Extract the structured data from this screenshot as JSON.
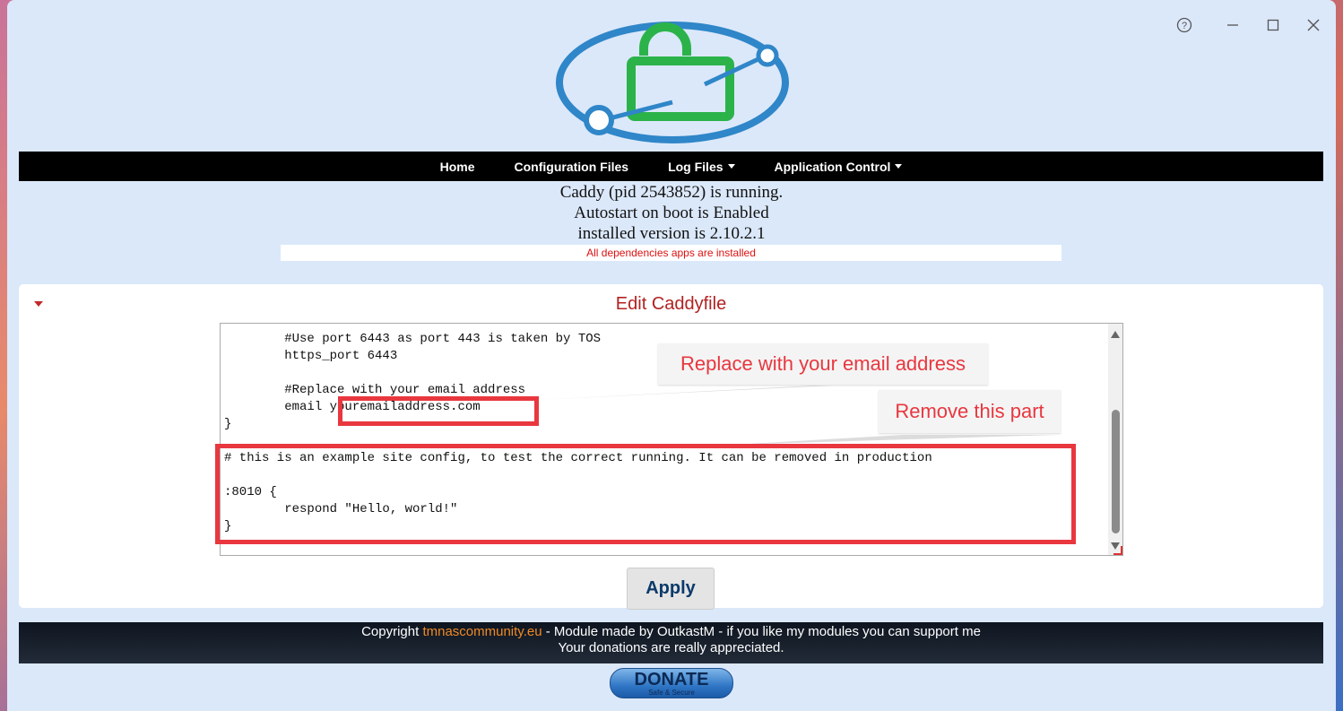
{
  "window": {
    "help_icon": "question-circle-icon",
    "minimize_icon": "minimize-icon",
    "maximize_icon": "maximize-icon",
    "close_icon": "close-icon"
  },
  "nav": {
    "items": [
      {
        "label": "Home",
        "dropdown": false
      },
      {
        "label": "Configuration Files",
        "dropdown": false
      },
      {
        "label": "Log Files",
        "dropdown": true
      },
      {
        "label": "Application Control",
        "dropdown": true
      }
    ]
  },
  "status": {
    "line1": "Caddy (pid 2543852) is running.",
    "line2": "Autostart on boot is Enabled",
    "line3": "installed version is 2.10.2.1",
    "deps": "All dependencies apps are installed"
  },
  "panel": {
    "title": "Edit Caddyfile",
    "apply_label": "Apply"
  },
  "editor": {
    "lines": [
      "        #Use port 6443 as port 443 is taken by TOS",
      "        https_port 6443",
      "",
      "        #Replace with your email address",
      "        email youremailaddress.com",
      "}",
      "",
      "# this is an example site config, to test the correct running. It can be removed in production",
      "",
      ":8010 {",
      "        respond \"Hello, world!\"",
      "}"
    ]
  },
  "annotations": {
    "email_callout": "Replace with your email address",
    "remove_callout": "Remove this part"
  },
  "footer": {
    "prefix": "Copyright ",
    "link": "tmnascommunity.eu",
    "suffix": " - Module made by OutkastM - if you like my modules you can support me",
    "line2": "Your donations are really appreciated."
  },
  "donate": {
    "label": "DONATE",
    "sub": "Safe & Secure"
  },
  "colors": {
    "accent_red": "#e8373f",
    "title_red": "#b22222",
    "nav_bg": "#000000",
    "link_orange": "#f08a24"
  }
}
